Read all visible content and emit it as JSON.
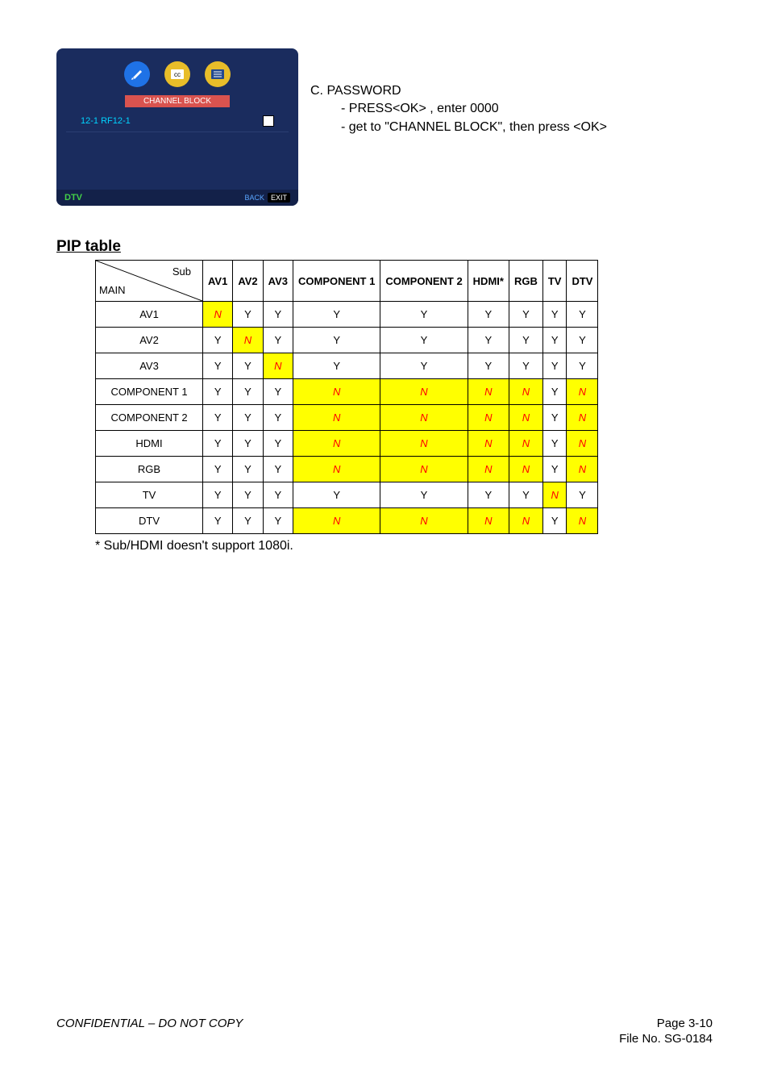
{
  "screenshot": {
    "channel_block_label": "CHANNEL BLOCK",
    "channel_row_label": "12-1 RF12-1",
    "dtv_label": "DTV",
    "back_label": "BACK",
    "exit_label": "EXIT"
  },
  "password": {
    "heading": "C. PASSWORD",
    "line1": "- PRESS<OK> , enter 0000",
    "line2": "- get to \"CHANNEL BLOCK\", then press <OK>"
  },
  "pip": {
    "heading": "PIP table",
    "diag_sub": "Sub",
    "diag_main": "MAIN",
    "columns": [
      "AV1",
      "AV2",
      "AV3",
      "COMPONENT 1",
      "COMPONENT 2",
      "HDMI*",
      "RGB",
      "TV",
      "DTV"
    ],
    "rows": [
      {
        "name": "AV1",
        "cells": [
          "N",
          "Y",
          "Y",
          "Y",
          "Y",
          "Y",
          "Y",
          "Y",
          "Y"
        ]
      },
      {
        "name": "AV2",
        "cells": [
          "Y",
          "N",
          "Y",
          "Y",
          "Y",
          "Y",
          "Y",
          "Y",
          "Y"
        ]
      },
      {
        "name": "AV3",
        "cells": [
          "Y",
          "Y",
          "N",
          "Y",
          "Y",
          "Y",
          "Y",
          "Y",
          "Y"
        ]
      },
      {
        "name": "COMPONENT 1",
        "cells": [
          "Y",
          "Y",
          "Y",
          "N",
          "N",
          "N",
          "N",
          "Y",
          "N"
        ]
      },
      {
        "name": "COMPONENT 2",
        "cells": [
          "Y",
          "Y",
          "Y",
          "N",
          "N",
          "N",
          "N",
          "Y",
          "N"
        ]
      },
      {
        "name": "HDMI",
        "cells": [
          "Y",
          "Y",
          "Y",
          "N",
          "N",
          "N",
          "N",
          "Y",
          "N"
        ]
      },
      {
        "name": "RGB",
        "cells": [
          "Y",
          "Y",
          "Y",
          "N",
          "N",
          "N",
          "N",
          "Y",
          "N"
        ]
      },
      {
        "name": "TV",
        "cells": [
          "Y",
          "Y",
          "Y",
          "Y",
          "Y",
          "Y",
          "Y",
          "N",
          "Y"
        ]
      },
      {
        "name": "DTV",
        "cells": [
          "Y",
          "Y",
          "Y",
          "N",
          "N",
          "N",
          "N",
          "Y",
          "N"
        ]
      }
    ],
    "footnote": "* Sub/HDMI doesn't support 1080i."
  },
  "footer": {
    "left": "CONFIDENTIAL – DO NOT COPY",
    "page_label": "Page  3-",
    "page_num": "10",
    "file_label": "File  No.  SG-0184"
  }
}
